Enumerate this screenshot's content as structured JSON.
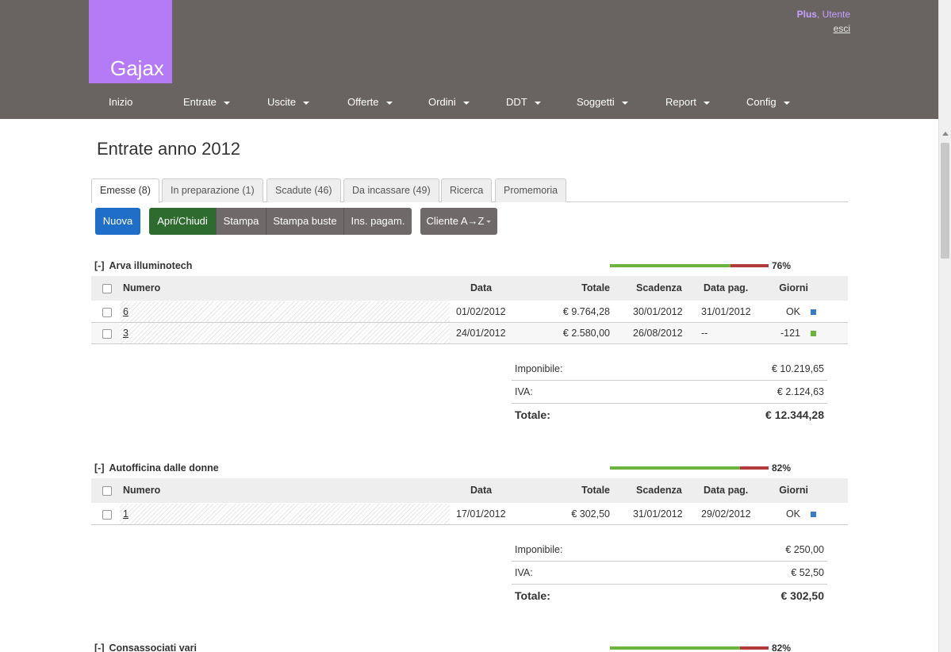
{
  "app": {
    "logo_text": "Gajax"
  },
  "user": {
    "plan": "Plus",
    "separator": ",",
    "name": "Utente",
    "logout": "esci"
  },
  "nav": [
    {
      "label": "Inizio",
      "has_menu": false
    },
    {
      "label": "Entrate",
      "has_menu": true
    },
    {
      "label": "Uscite",
      "has_menu": true
    },
    {
      "label": "Offerte",
      "has_menu": true
    },
    {
      "label": "Ordini",
      "has_menu": true
    },
    {
      "label": "DDT",
      "has_menu": true
    },
    {
      "label": "Soggetti",
      "has_menu": true
    },
    {
      "label": "Report",
      "has_menu": true
    },
    {
      "label": "Config",
      "has_menu": true
    }
  ],
  "page": {
    "title": "Entrate anno 2012"
  },
  "tabs": [
    {
      "label": "Emesse (8)",
      "active": true
    },
    {
      "label": "In preparazione (1)",
      "active": false
    },
    {
      "label": "Scadute (46)",
      "active": false
    },
    {
      "label": "Da incassare (49)",
      "active": false
    },
    {
      "label": "Ricerca",
      "active": false
    },
    {
      "label": "Promemoria",
      "active": false
    }
  ],
  "toolbar": {
    "new": "Nuova",
    "toggle": "Apri/Chiudi",
    "print": "Stampa",
    "print_envelopes": "Stampa buste",
    "add_payment": "Ins. pagam.",
    "sort": "Cliente A→Z"
  },
  "columns": {
    "numero": "Numero",
    "data": "Data",
    "totale": "Totale",
    "scadenza": "Scadenza",
    "data_pag": "Data pag.",
    "giorni": "Giorni"
  },
  "summary_labels": {
    "imponibile": "Imponibile:",
    "iva": "IVA:",
    "totale": "Totale:"
  },
  "colors": {
    "status_blue": "#3a7bc8",
    "status_green": "#6db33f",
    "progress_green": "#6db33f",
    "progress_red": "#b33a3a"
  },
  "groups": [
    {
      "toggle": "[-]",
      "name": "Arva illuminotech",
      "paid_fraction": 0.76,
      "pct_label": "76%",
      "rows": [
        {
          "numero": "6",
          "data": "01/02/2012",
          "totale": "€ 9.764,28",
          "scadenza": "30/01/2012",
          "data_pag": "31/01/2012",
          "giorni": "OK",
          "status_color": "#3a7bc8"
        },
        {
          "numero": "3",
          "data": "24/01/2012",
          "totale": "€ 2.580,00",
          "scadenza": "26/08/2012",
          "data_pag": "--",
          "giorni": "-121",
          "status_color": "#6db33f"
        }
      ],
      "imponibile": "€ 10.219,65",
      "iva": "€ 2.124,63",
      "totale": "€ 12.344,28"
    },
    {
      "toggle": "[-]",
      "name": "Autofficina dalle donne",
      "paid_fraction": 0.82,
      "pct_label": "82%",
      "rows": [
        {
          "numero": "1",
          "data": "17/01/2012",
          "totale": "€ 302,50",
          "scadenza": "31/01/2012",
          "data_pag": "29/02/2012",
          "giorni": "OK",
          "status_color": "#3a7bc8"
        }
      ],
      "imponibile": "€ 250,00",
      "iva": "€ 52,50",
      "totale": "€ 302,50"
    },
    {
      "toggle": "[-]",
      "name": "Consassociati vari",
      "paid_fraction": 0.82,
      "pct_label": "82%",
      "rows": []
    }
  ]
}
